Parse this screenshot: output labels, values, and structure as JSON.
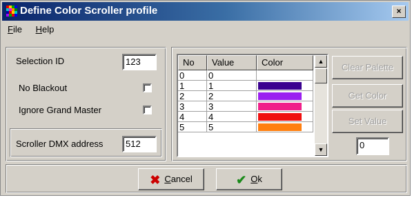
{
  "window": {
    "title": "Define Color Scroller profile",
    "close_glyph": "×"
  },
  "menu": [
    {
      "label": "File"
    },
    {
      "label": "Help"
    }
  ],
  "left_panel": {
    "selection_id_label": "Selection ID",
    "selection_id_value": "123",
    "no_blackout_label": "No Blackout",
    "no_blackout_checked": false,
    "ignore_grand_master_label": "Ignore Grand Master",
    "ignore_grand_master_checked": false,
    "dmx_label": "Scroller DMX address",
    "dmx_value": "512"
  },
  "grid": {
    "columns": [
      "No",
      "Value",
      "Color"
    ],
    "rows": [
      {
        "no": "0",
        "value": "0",
        "color": "#ffffff"
      },
      {
        "no": "1",
        "value": "1",
        "color": "#3a0090"
      },
      {
        "no": "2",
        "value": "2",
        "color": "#9a20f0"
      },
      {
        "no": "3",
        "value": "3",
        "color": "#f0208a"
      },
      {
        "no": "4",
        "value": "4",
        "color": "#f01010"
      },
      {
        "no": "5",
        "value": "5",
        "color": "#ff7f10"
      }
    ]
  },
  "side_buttons": {
    "clear_palette": "Clear Palette",
    "get_color": "Get Color",
    "set_value": "Set Value",
    "value_input": "0"
  },
  "footer": {
    "cancel_label": "Cancel",
    "ok_label": "Ok"
  },
  "colors": {
    "cancel_icon": "#cc0000",
    "ok_icon": "#1a8a1a"
  }
}
